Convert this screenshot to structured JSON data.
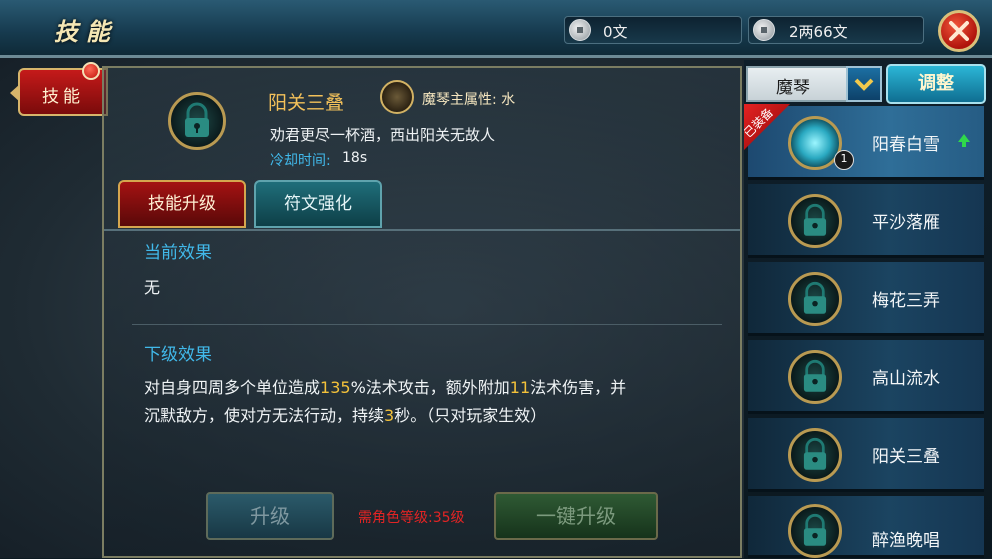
{
  "topbar": {
    "title": "技能",
    "coin1": "0文",
    "coin2": "2两66文",
    "icons": {
      "coin": "coin-icon",
      "coin_lock": "locked-coin-icon",
      "close": "close-icon"
    }
  },
  "side_tab": {
    "label": "技能"
  },
  "skill": {
    "name": "阳关三叠",
    "attr": "魔琴主属性: 水",
    "desc": "劝君更尽一杯酒，西出阳关无故人",
    "cooldown_label": "冷却时间:",
    "cooldown_value": "18s"
  },
  "tabs": [
    {
      "label": "技能升级",
      "active": true
    },
    {
      "label": "符文强化",
      "active": false
    }
  ],
  "current_effect": {
    "title": "当前效果",
    "text": "无"
  },
  "next_effect": {
    "title": "下级效果",
    "line1_a": "对自身四周多个单位造成",
    "line1_b": "135",
    "line1_c": "%法术攻击，额外附加",
    "line1_d": "11",
    "line1_e": "法术伤害，并",
    "line2_a": "沉默敌方，使对方无法行动，持续",
    "line2_b": "3",
    "line2_c": "秒。（只对玩家生效）"
  },
  "buttons": {
    "upgrade": "升级",
    "need_level": "需角色等级:35级",
    "one_click": "一键升级"
  },
  "right": {
    "dropdown_value": "魔琴",
    "adjust": "调整",
    "equipped_badge": "已装备",
    "items": [
      {
        "name": "阳春白雪",
        "badge": "1"
      },
      {
        "name": "平沙落雁"
      },
      {
        "name": "梅花三弄"
      },
      {
        "name": "高山流水"
      },
      {
        "name": "阳关三叠"
      },
      {
        "name": "醉渔晚唱"
      }
    ]
  },
  "colors": {
    "accent_blue": "#41b9ea",
    "highlight": "#f3c13a",
    "warning": "#e32424"
  }
}
